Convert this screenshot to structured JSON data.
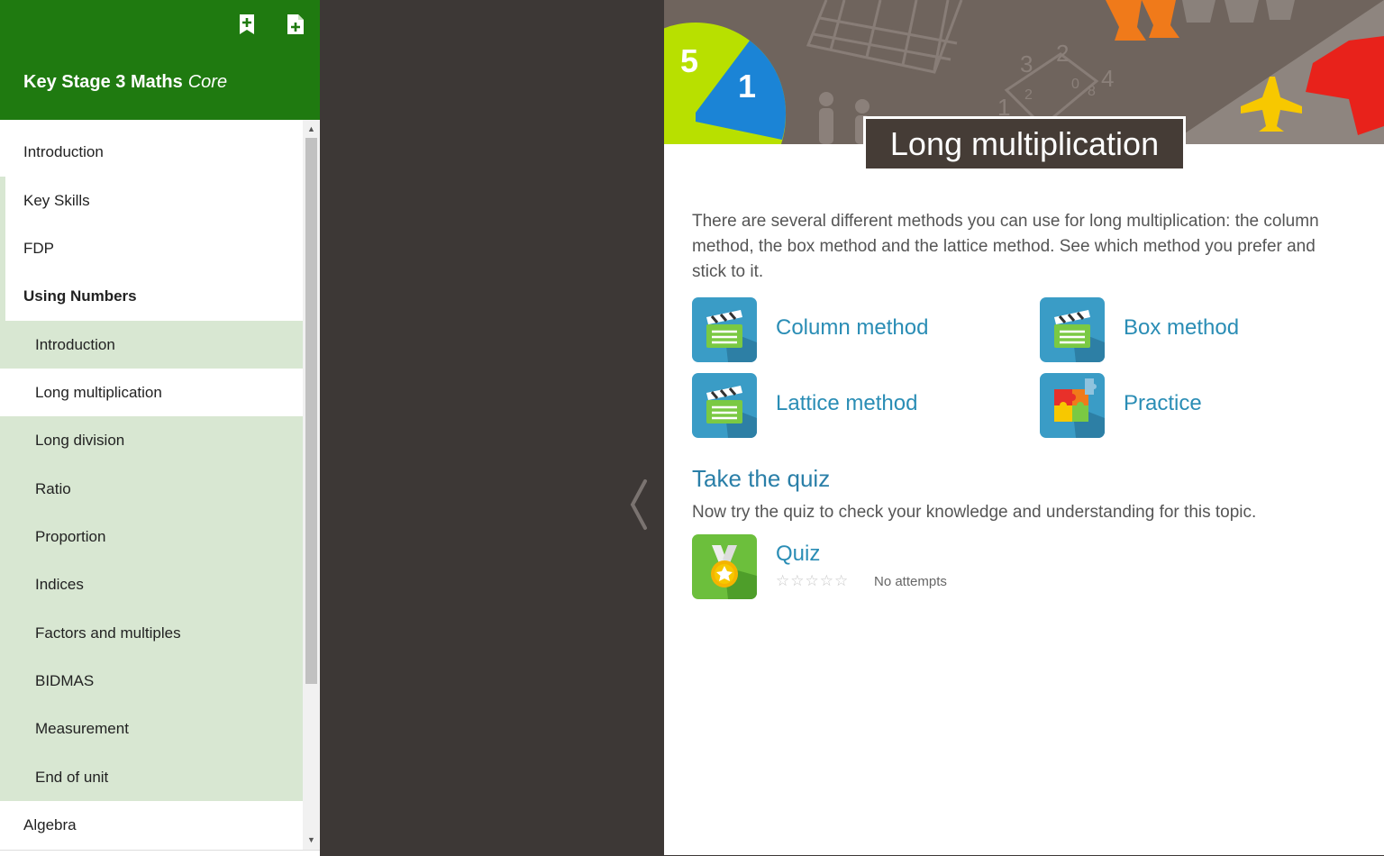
{
  "sidebar": {
    "course_title": "Key Stage 3 Maths",
    "course_level": "Core",
    "header_icons": [
      "bookmark-add-icon",
      "file-add-icon"
    ],
    "nav": [
      {
        "label": "Introduction",
        "level": "top"
      },
      {
        "label": "Key Skills",
        "level": "top"
      },
      {
        "label": "FDP",
        "level": "top"
      },
      {
        "label": "Using Numbers",
        "level": "top",
        "expanded": true
      },
      {
        "label": "Introduction",
        "level": "sub"
      },
      {
        "label": "Long multiplication",
        "level": "sub",
        "active": true
      },
      {
        "label": "Long division",
        "level": "sub"
      },
      {
        "label": "Ratio",
        "level": "sub"
      },
      {
        "label": "Proportion",
        "level": "sub"
      },
      {
        "label": "Indices",
        "level": "sub"
      },
      {
        "label": "Factors and multiples",
        "level": "sub"
      },
      {
        "label": "BIDMAS",
        "level": "sub"
      },
      {
        "label": "Measurement",
        "level": "sub"
      },
      {
        "label": "End of unit",
        "level": "sub"
      },
      {
        "label": "Algebra",
        "level": "top"
      }
    ]
  },
  "banner": {
    "pie_numbers": [
      "5",
      "1"
    ],
    "grid_numbers": [
      "3",
      "2",
      "1",
      "2",
      "0",
      "8",
      "4"
    ]
  },
  "page": {
    "title": "Long multiplication",
    "intro": "There are several different methods you can use for long multiplication: the column method, the box method and the lattice method. See which method you prefer and stick to it."
  },
  "resources": [
    {
      "label": "Column method",
      "icon": "video-clapper-icon"
    },
    {
      "label": "Box method",
      "icon": "video-clapper-icon"
    },
    {
      "label": "Lattice method",
      "icon": "video-clapper-icon"
    },
    {
      "label": "Practice",
      "icon": "puzzle-icon"
    }
  ],
  "quiz": {
    "heading": "Take the quiz",
    "description": "Now try the quiz to check your knowledge and understanding for this topic.",
    "label": "Quiz",
    "icon": "medal-icon",
    "rating": 0,
    "rating_max": 5,
    "stars_display": "☆☆☆☆☆",
    "attempts": "No attempts"
  },
  "colors": {
    "header_green": "#1f7a10",
    "sub_nav_bg": "#d8e7d2",
    "link_blue": "#2a8db5",
    "icon_blue": "#3a9cc6",
    "icon_green": "#6cbf3c",
    "title_box": "#453c36"
  }
}
